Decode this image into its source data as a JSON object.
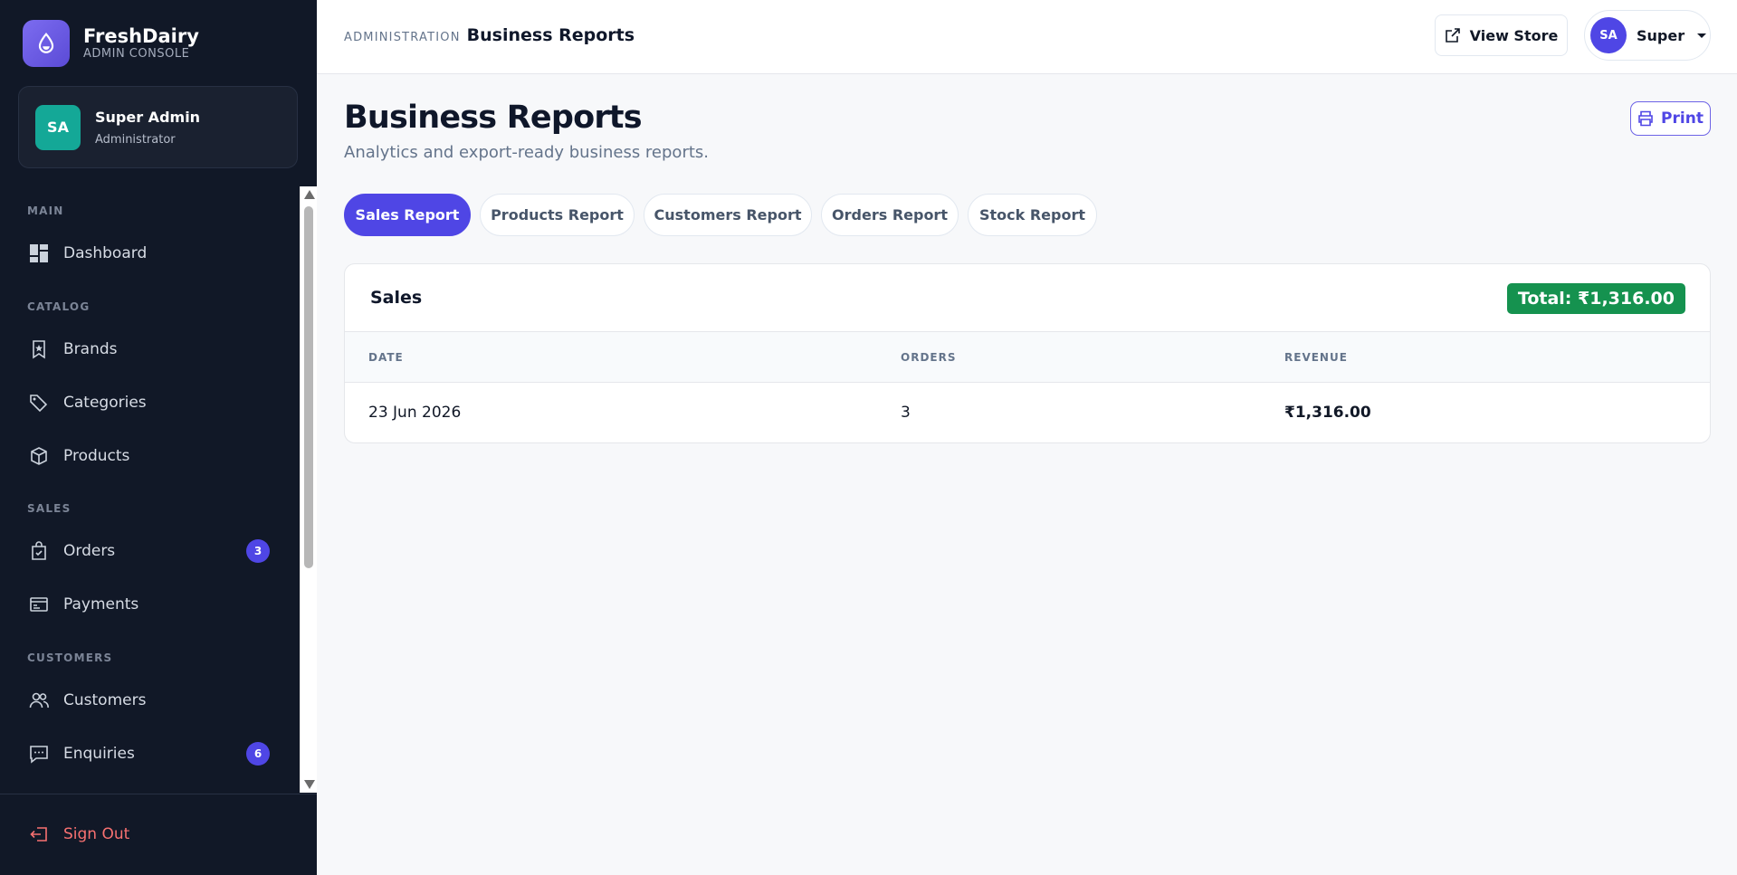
{
  "brand": {
    "name": "FreshDairy",
    "subtitle": "ADMIN CONSOLE"
  },
  "user": {
    "initials": "SA",
    "name": "Super Admin",
    "role": "Administrator"
  },
  "sidebar": {
    "sections": [
      {
        "label": "MAIN"
      },
      {
        "label": "CATALOG"
      },
      {
        "label": "SALES"
      },
      {
        "label": "CUSTOMERS"
      }
    ],
    "items": [
      {
        "label": "Dashboard",
        "icon": "dashboard-icon"
      },
      {
        "label": "Brands",
        "icon": "bookmark-star-icon"
      },
      {
        "label": "Categories",
        "icon": "tag-icon"
      },
      {
        "label": "Products",
        "icon": "box-icon"
      },
      {
        "label": "Orders",
        "icon": "shopping-bag-check-icon",
        "badge": "3"
      },
      {
        "label": "Payments",
        "icon": "payment-card-icon"
      },
      {
        "label": "Customers",
        "icon": "users-icon"
      },
      {
        "label": "Enquiries",
        "icon": "chat-icon",
        "badge": "6"
      }
    ],
    "signout": "Sign Out"
  },
  "header": {
    "section": "ADMINISTRATION",
    "page": "Business Reports",
    "view_store": "View Store",
    "user_initials": "SA",
    "user_name": "Super"
  },
  "main": {
    "title": "Business Reports",
    "subtitle": "Analytics and export-ready business reports.",
    "print_label": "Print",
    "tabs": [
      {
        "label": "Sales Report",
        "active": true
      },
      {
        "label": "Products Report",
        "active": false
      },
      {
        "label": "Customers Report",
        "active": false
      },
      {
        "label": "Orders Report",
        "active": false
      },
      {
        "label": "Stock Report",
        "active": false
      }
    ],
    "card": {
      "title": "Sales",
      "total": "Total: ₹1,316.00",
      "columns": [
        "DATE",
        "ORDERS",
        "REVENUE"
      ],
      "rows": [
        {
          "date": "23 Jun 2026",
          "orders": "3",
          "revenue": "₹1,316.00"
        }
      ]
    }
  },
  "colors": {
    "sidebar_bg": "#111827",
    "accent": "#4f46e5",
    "success": "#15924f",
    "danger": "#f87171"
  }
}
